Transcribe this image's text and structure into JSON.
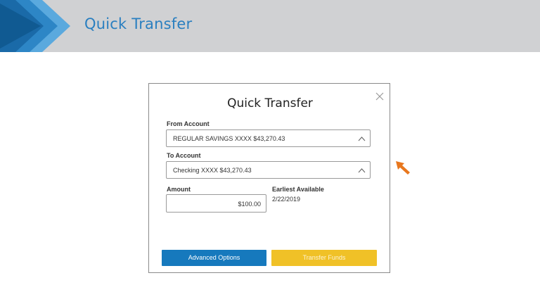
{
  "banner": {
    "title": "Quick Transfer"
  },
  "modal": {
    "title": "Quick Transfer",
    "from_label": "From Account",
    "from_value": "REGULAR SAVINGS XXXX $43,270.43",
    "to_label": "To Account",
    "to_value": "Checking XXXX $43,270.43",
    "amount_label": "Amount",
    "amount_value": "$100.00",
    "earliest_label": "Earliest Available",
    "earliest_value": "2/22/2019",
    "advanced_button": "Advanced Options",
    "transfer_button": "Transfer Funds"
  },
  "colors": {
    "accent_blue": "#1679bd",
    "transfer_yellow": "#f0c127",
    "pointer_orange": "#e8771e"
  },
  "icons": [
    "close-icon",
    "chevron-up-icon",
    "arrow-pointer-icon"
  ]
}
